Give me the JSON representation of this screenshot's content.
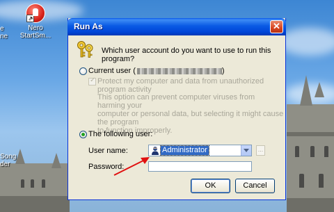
{
  "desktop": {
    "nero_icon_label_line1": "Nero",
    "nero_icon_label_line2": "StartSm...",
    "left_edge_text_top": "e",
    "left_edge_text_top2": "ne",
    "left_edge_text_song": "Song",
    "left_edge_text_der": "der"
  },
  "dialog": {
    "title": "Run As",
    "close_glyph": "✕",
    "question": "Which user account do you want to use to run this program?",
    "current_user_label": "Current user (",
    "current_user_tail": ")",
    "protect_label": "Protect my computer and data from unauthorized program activity",
    "description_line1": "This option can prevent computer viruses from harming your",
    "description_line2": "computer or personal data, but selecting it might cause the program",
    "description_line3": "to function improperly.",
    "following_user_label": "The following user:",
    "username_label": "User name:",
    "username_value": "Administrator",
    "password_label": "Password:",
    "password_value": "",
    "browse_label": "...",
    "ok_label": "OK",
    "cancel_label": "Cancel",
    "selected_option": "following_user"
  },
  "colors": {
    "titlebar": "#0a58e8",
    "dialog_bg": "#ece9d8",
    "selection": "#316ac5",
    "annotation_arrow": "#e01010",
    "close_button": "#d9451f"
  },
  "icons": [
    "keys-icon",
    "user-icon",
    "nero-icon",
    "close-icon",
    "dropdown-arrow-icon"
  ]
}
